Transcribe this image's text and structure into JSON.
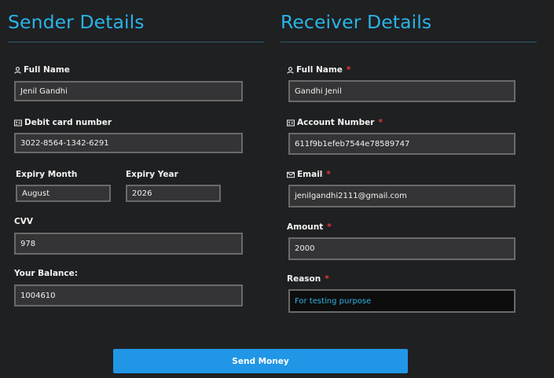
{
  "sender": {
    "title": "Sender Details",
    "full_name_label": "Full Name",
    "full_name_value": "Jenil Gandhi",
    "card_label": "Debit card number",
    "card_value": "3022-8564-1342-6291",
    "expiry_month_label": "Expiry Month",
    "expiry_month_value": "August",
    "expiry_year_label": "Expiry Year",
    "expiry_year_value": "2026",
    "cvv_label": "CVV",
    "cvv_value": "978",
    "balance_label": "Your Balance:",
    "balance_value": "1004610"
  },
  "receiver": {
    "title": "Receiver Details",
    "full_name_label": "Full Name",
    "full_name_value": "Gandhi Jenil",
    "account_label": "Account Number",
    "account_value": "611f9b1efeb7544e78589747",
    "email_label": "Email",
    "email_value": "jenilgandhi2111@gmail.com",
    "amount_label": "Amount",
    "amount_value": "2000",
    "reason_label": "Reason",
    "reason_value": "For testing purpose",
    "required_mark": "*"
  },
  "actions": {
    "send_label": "Send Money"
  },
  "icons": {
    "user": "user-icon",
    "card": "id-card-icon",
    "mail": "envelope-icon"
  },
  "colors": {
    "background": "#1f2022",
    "accent": "#2ab4e6",
    "button": "#2196e6",
    "required": "#e53935"
  }
}
